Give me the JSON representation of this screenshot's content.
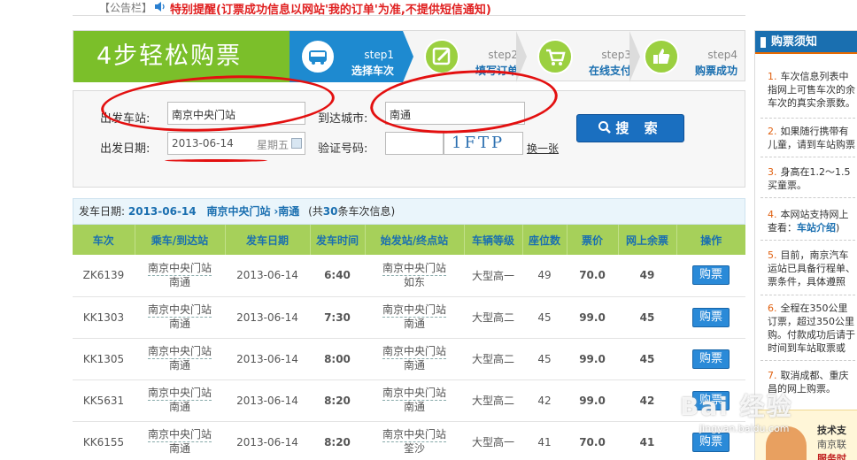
{
  "notice": {
    "label": "【公告栏】",
    "text": "特别提醒(订票成功信息以网站'我的订单'为准,不提供短信通知)"
  },
  "steps": {
    "title": "4步轻松购票",
    "items": [
      {
        "num": "step1",
        "name": "选择车次",
        "icon": "bus-icon"
      },
      {
        "num": "step2",
        "name": "填写订单",
        "icon": "edit-icon"
      },
      {
        "num": "step3",
        "name": "在线支付",
        "icon": "cart-icon"
      },
      {
        "num": "step4",
        "name": "购票成功",
        "icon": "thumbs-up-icon"
      }
    ]
  },
  "search": {
    "from_label": "出发车站:",
    "from_value": "南京中央门站",
    "to_label": "到达城市:",
    "to_value": "南通",
    "date_label": "出发日期:",
    "date_value": "2013-06-14",
    "weekday": "星期五",
    "captcha_label": "验证号码:",
    "captcha_text": "1FTP",
    "switch_link": "换一张",
    "search_button": "搜 索"
  },
  "result_info": {
    "prefix": "发车日期:",
    "date": "2013-06-14",
    "from": "南京中央门站",
    "to": "›南通",
    "count_prefix": "(共",
    "count": "30",
    "count_suffix": "条车次信息)"
  },
  "table": {
    "headers": [
      "车次",
      "乘车/到达站",
      "发车日期",
      "发车时间",
      "始发站/终点站",
      "车辆等级",
      "座位数",
      "票价",
      "网上余票",
      "操作"
    ],
    "rows": [
      {
        "no": "ZK6139",
        "board": "南京中央门站",
        "arrive": "南通",
        "date": "2013-06-14",
        "time": "6:40",
        "origin": "南京中央门站",
        "terminal": "如东",
        "grade": "大型高一",
        "seats": "49",
        "price": "70.0",
        "left": "49",
        "action": "购票"
      },
      {
        "no": "KK1303",
        "board": "南京中央门站",
        "arrive": "南通",
        "date": "2013-06-14",
        "time": "7:30",
        "origin": "南京中央门站",
        "terminal": "南通",
        "grade": "大型高二",
        "seats": "45",
        "price": "99.0",
        "left": "45",
        "action": "购票"
      },
      {
        "no": "KK1305",
        "board": "南京中央门站",
        "arrive": "南通",
        "date": "2013-06-14",
        "time": "8:00",
        "origin": "南京中央门站",
        "terminal": "南通",
        "grade": "大型高二",
        "seats": "45",
        "price": "99.0",
        "left": "45",
        "action": "购票"
      },
      {
        "no": "KK5631",
        "board": "南京中央门站",
        "arrive": "南通",
        "date": "2013-06-14",
        "time": "8:20",
        "origin": "南京中央门站",
        "terminal": "南通",
        "grade": "大型高二",
        "seats": "42",
        "price": "99.0",
        "left": "42",
        "action": "购票"
      },
      {
        "no": "KK6155",
        "board": "南京中央门站",
        "arrive": "南通",
        "date": "2013-06-14",
        "time": "8:20",
        "origin": "南京中央门站",
        "terminal": "筌沙",
        "grade": "大型高一",
        "seats": "41",
        "price": "70.0",
        "left": "41",
        "action": "购票"
      }
    ]
  },
  "sidebar": {
    "title": "购票须知",
    "items": [
      {
        "n": "1.",
        "lines": [
          "车次信息列表中",
          "指网上可售车次的余",
          "车次的真实余票数。"
        ]
      },
      {
        "n": "2.",
        "lines": [
          "如果随行携带有",
          "儿童，请到车站购票"
        ]
      },
      {
        "n": "3.",
        "lines": [
          "身高在1.2～1.5",
          "买童票。"
        ]
      },
      {
        "n": "4.",
        "lines": [
          "本网站支持网上",
          "查看：车站介绍)"
        ]
      },
      {
        "n": "5.",
        "lines": [
          "目前，南京汽车",
          "运站已具备行程单、",
          "票条件，具体遵照"
        ]
      },
      {
        "n": "6.",
        "lines": [
          "全程在350公里",
          "订票，超过350公里",
          "购。付款成功后请于",
          "时间到车站取票或"
        ]
      },
      {
        "n": "7.",
        "lines": [
          "取消成都、重庆",
          "昌的网上购票。"
        ]
      }
    ],
    "link": "车站介绍",
    "help_a": "技术支",
    "help_b": "南京联",
    "help_c": "服务时"
  },
  "watermark": {
    "main": "Bai 经验",
    "sub": "jingyan.baidu.com"
  },
  "colors": {
    "accent": "#1a6fb0",
    "green": "#7bbf2a",
    "price": "#c0392b",
    "annotation": "#e31010"
  }
}
